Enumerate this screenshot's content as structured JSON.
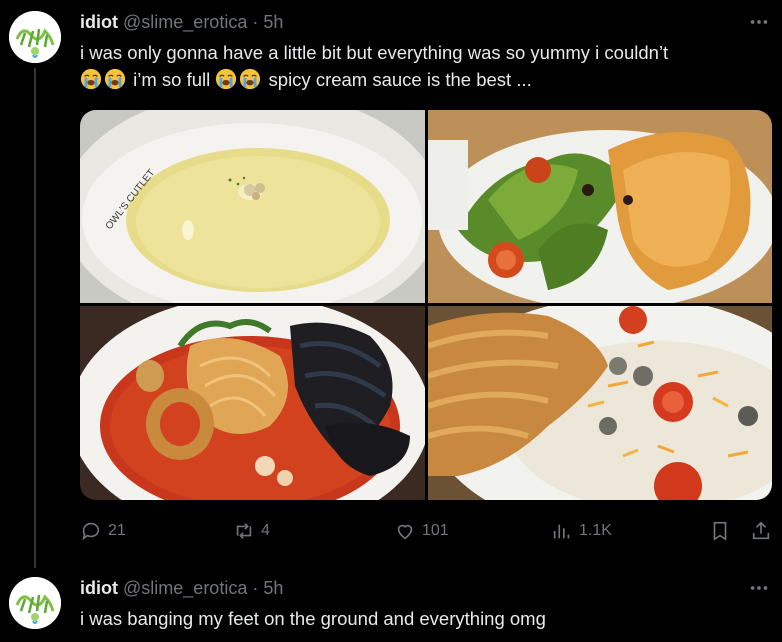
{
  "tweets": [
    {
      "name": "idiot",
      "handle": "@slime_erotica",
      "separator": "·",
      "time": "5h",
      "text_line1": "i was only gonna have a little bit but everything was so yummy i couldn’t",
      "text_part2": "i’m so full",
      "text_part3": "spicy cream sauce is the best ...",
      "emoji": "loudly-crying-face",
      "media": [
        {
          "description": "corn soup"
        },
        {
          "description": "salad with fried chicken"
        },
        {
          "description": "seafood spaghetti"
        },
        {
          "description": "chicken cutlet with cream sauce"
        }
      ],
      "bowl_text": "OWL'S CUTLET",
      "actions": {
        "replies": "21",
        "reposts": "4",
        "likes": "101",
        "views": "1.1K"
      }
    },
    {
      "name": "idiot",
      "handle": "@slime_erotica",
      "separator": "·",
      "time": "5h",
      "text": "i was banging my feet on the ground and everything omg"
    }
  ],
  "colors": {
    "background": "#000000",
    "text": "#e7e9ea",
    "secondary": "#71767b"
  },
  "icons": [
    "reply-icon",
    "repost-icon",
    "like-icon",
    "views-icon",
    "bookmark-icon",
    "share-icon",
    "more-icon"
  ]
}
